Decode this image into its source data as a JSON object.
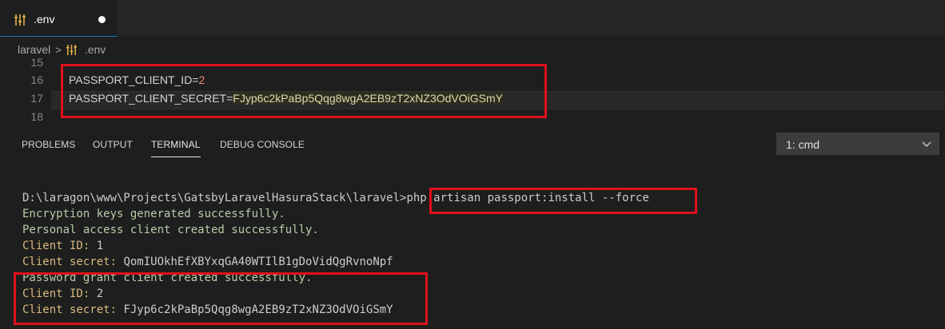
{
  "tab": {
    "icon": "settings-file-icon",
    "label": ".env",
    "unsaved": true
  },
  "breadcrumb": {
    "folder": "laravel",
    "separator": ">",
    "file_icon": "settings-file-icon",
    "file": ".env"
  },
  "editor": {
    "lines": [
      {
        "num": "15",
        "text": ""
      },
      {
        "num": "16",
        "key": "PASSPORT_CLIENT_ID",
        "eq": "=",
        "value": "2"
      },
      {
        "num": "17",
        "key": "PASSPORT_CLIENT_SECRET",
        "eq": "=",
        "value": "FJyp6c2kPaBp5Qqg8wgA2EB9zT2xNZ3OdVOiGSmY"
      },
      {
        "num": "18",
        "text": ""
      }
    ]
  },
  "panel": {
    "tabs": [
      "PROBLEMS",
      "OUTPUT",
      "TERMINAL",
      "DEBUG CONSOLE"
    ],
    "active_tab": "TERMINAL",
    "terminal_select": "1: cmd"
  },
  "terminal": {
    "prompt": "D:\\laragon\\www\\Projects\\GatsbyLaravelHasuraStack\\laravel>",
    "command": "php artisan passport:install --force",
    "line1": "Encryption keys generated successfully.",
    "line2": "Personal access client created successfully.",
    "client_id_label1": "Client ID:",
    "client_id_value1": "1",
    "client_secret_label1": "Client secret:",
    "client_secret_value1": "QomIUOkhEfXBYxqGA40WTIlB1gDoVidQgRvnoNpf",
    "line3": "Password grant client created successfully.",
    "client_id_label2": "Client ID:",
    "client_id_value2": "2",
    "client_secret_label2": "Client secret:",
    "client_secret_value2": "FJyp6c2kPaBp5Qqg8wgA2EB9zT2xNZ3OdVOiGSmY"
  },
  "colors": {
    "highlight_box": "#e0101b",
    "accent": "#0e7ac4"
  }
}
